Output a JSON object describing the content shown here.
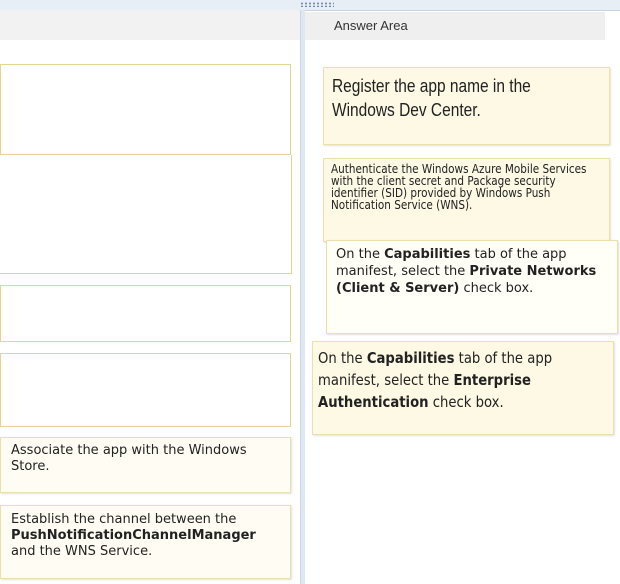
{
  "answer_area": {
    "header": "Answer Area"
  },
  "choices": [
    {
      "id": "register",
      "text": "Register the app name in the Windows Dev Center."
    },
    {
      "id": "authenticate",
      "text": "Authenticate the Windows Azure Mobile Services with the client secret and Package security identifier (SID) provided by Windows Push Notification Service (WNS)."
    },
    {
      "id": "private-networks",
      "pre": "On the ",
      "b1": "Capabilities",
      "mid": " tab of the app manifest, select the ",
      "b2": "Private Networks (Client & Server)",
      "post": " check box."
    },
    {
      "id": "enterprise-auth",
      "pre": "On the ",
      "b1": "Capabilities",
      "mid": " tab of the app manifest, select the ",
      "b2": "Enterprise Authentication",
      "post": " check box."
    },
    {
      "id": "associate",
      "text": "Associate the app with the Windows Store."
    },
    {
      "id": "establish",
      "pre": "Establish the channel between the ",
      "b1": "PushNotificationChannelManager",
      "post": " and the WNS Service."
    }
  ]
}
